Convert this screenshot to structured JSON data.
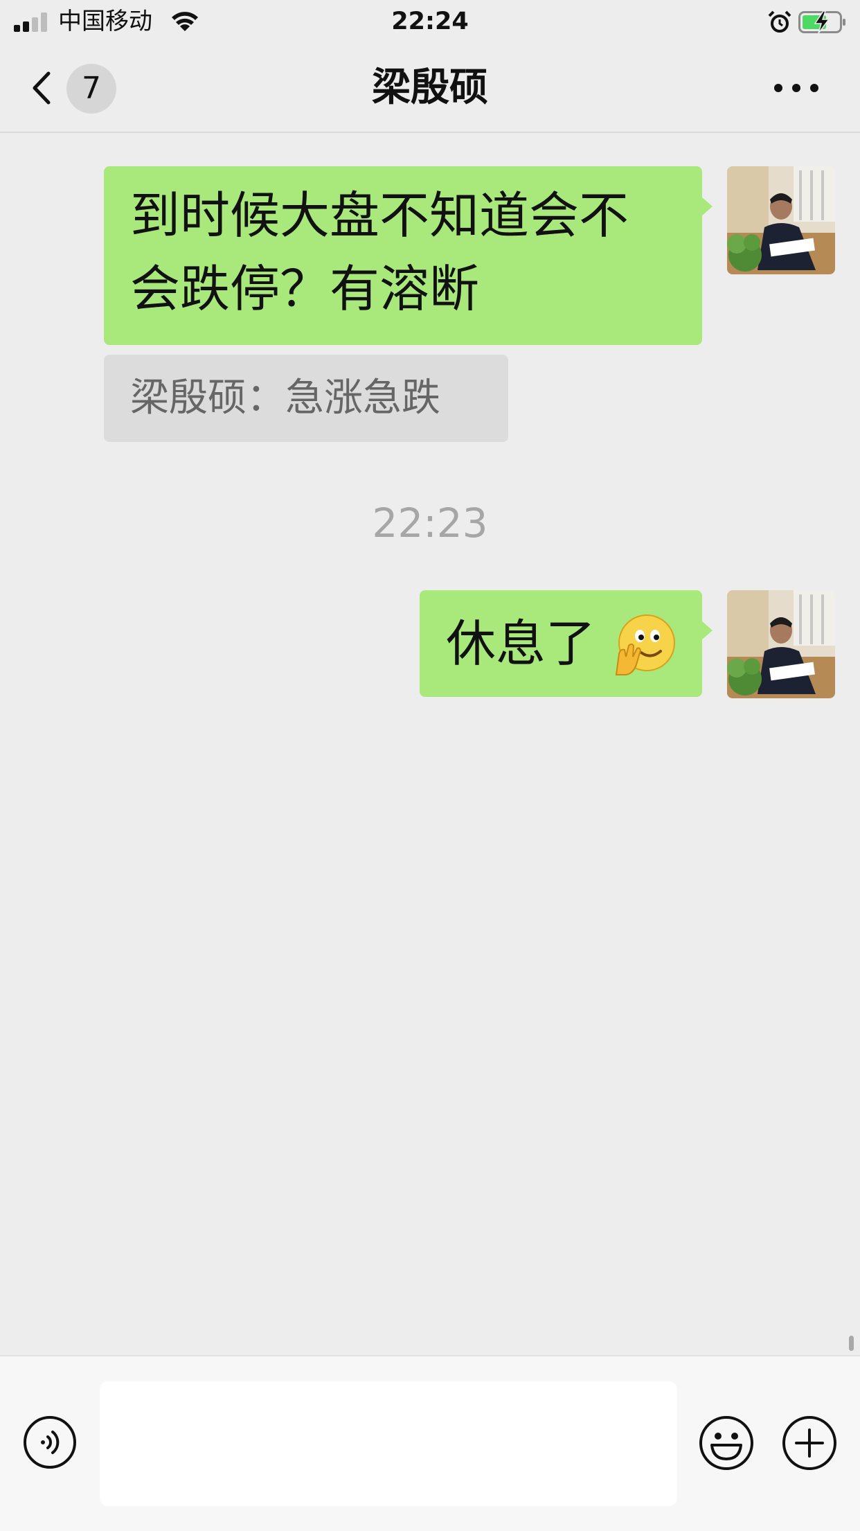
{
  "status_bar": {
    "carrier": "中国移动",
    "time": "22:24",
    "signal_bars": 2,
    "battery_charging": true
  },
  "header": {
    "back_badge": "7",
    "title": "梁殷硕"
  },
  "messages": [
    {
      "type": "outgoing",
      "lines": [
        "到时候大盘不知道会不",
        "会跌停？有溶断"
      ],
      "quote": "梁殷硕：急涨急跌"
    },
    {
      "type": "timestamp",
      "text": "22:23"
    },
    {
      "type": "outgoing",
      "text": "休息了",
      "emoji": "smiling-face-with-hand-over-cheek"
    }
  ],
  "input_bar": {
    "placeholder": ""
  },
  "colors": {
    "background": "#ededed",
    "bubble_outgoing": "#a9e97c",
    "quote_background": "#dcdcdc",
    "timestamp_text": "#a6a6a6",
    "input_bar": "#f7f7f7"
  },
  "icons": {
    "back": "chevron-left-icon",
    "more": "ellipsis-icon",
    "voice": "voice-icon",
    "emoji": "emoji-icon",
    "plus": "plus-icon",
    "wifi": "wifi-icon",
    "alarm": "alarm-icon",
    "battery": "battery-icon"
  }
}
